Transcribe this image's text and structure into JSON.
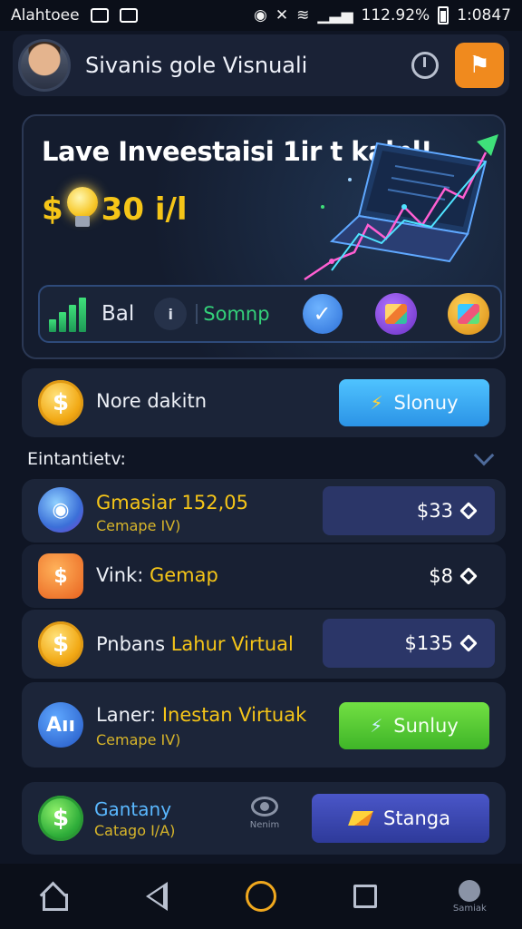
{
  "status_bar": {
    "carrier": "Alahtoee",
    "battery": "112.92%",
    "time": "1:0847"
  },
  "header": {
    "title": "Sivanis gole Visnuali"
  },
  "hero": {
    "title": "Lave Inveestaisi 1ir t kalnl!",
    "amount_prefix": "$",
    "amount_suffix": "30 i/l",
    "stats": {
      "label": "Bal",
      "pill": "i",
      "green_label": "Somnp"
    }
  },
  "summary_card": {
    "label": "Nore dakitn",
    "button": "Slonuy"
  },
  "section": {
    "title": "Eintantietv:"
  },
  "list": [
    {
      "title": "Gmasiar 152,05",
      "subtitle": "Cemape IV)",
      "price": "$33"
    },
    {
      "title_main": "Vink: ",
      "title_accent": "Gemap",
      "price": "$8"
    },
    {
      "title_main": "Pnbans ",
      "title_accent": "Lahur Virtual",
      "price": "$135"
    },
    {
      "icon_text": "Aıı",
      "title_main": "Laner: ",
      "title_accent": "Inestan Virtuak",
      "subtitle": "Cemape IV)",
      "button": "Sunluy"
    }
  ],
  "bottom_card": {
    "title": "Gantany",
    "subtitle": "Catago I/A)",
    "center_label": "Nenim",
    "button": "Stanga"
  },
  "navbar": {
    "profile_label": "Samiak"
  },
  "colors": {
    "background": "#0f1524",
    "card": "#1b2438",
    "accent_gold": "#f5c518",
    "accent_green": "#34d17a",
    "button_blue": "#4fc3ff",
    "button_green": "#72e043",
    "button_indigo": "#4a56c8",
    "alert_orange": "#f08a1e"
  },
  "icons": {
    "notification": "bell-icon",
    "clock": "clock-icon",
    "coin": "dollar-coin-icon",
    "check": "check-badge-icon",
    "chevron": "chevron-down-icon",
    "home": "home-icon",
    "back": "back-icon",
    "recents": "recents-icon"
  }
}
